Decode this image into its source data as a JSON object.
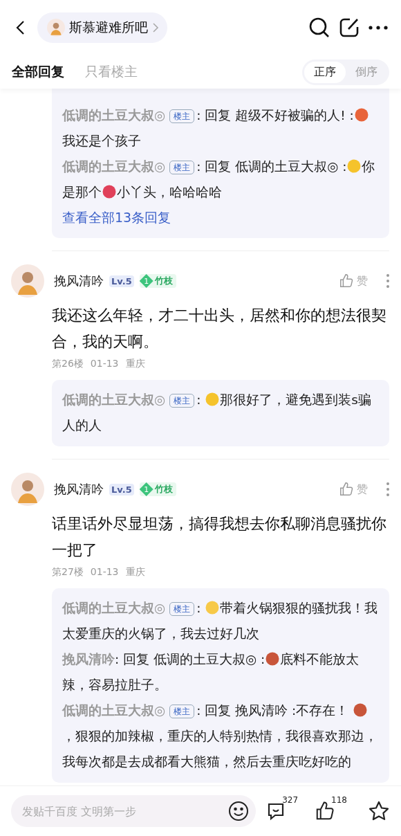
{
  "header": {
    "forum_name": "斯慕避难所吧"
  },
  "tabs": [
    {
      "label": "全部回复",
      "selected": true
    },
    {
      "label": "只看楼主",
      "selected": false
    }
  ],
  "sort": [
    {
      "label": "正序",
      "selected": true
    },
    {
      "label": "倒序",
      "selected": false
    }
  ],
  "thread_tail": {
    "replies": [
      {
        "author": "低调的土豆大叔◎",
        "badge": "楼主",
        "segments": [
          {
            "kind": "text",
            "text": ":  回复 超级不好被骗的人! :"
          },
          {
            "kind": "emoji",
            "color": "#e8643a"
          },
          {
            "kind": "text",
            "text": "我还是个孩子"
          }
        ]
      },
      {
        "author": "低调的土豆大叔◎",
        "badge": "楼主",
        "segments": [
          {
            "kind": "text",
            "text": ":  回复 低调的土豆大叔◎ :"
          },
          {
            "kind": "emoji",
            "color": "#f5c32c"
          },
          {
            "kind": "text",
            "text": "你是那个"
          },
          {
            "kind": "emoji",
            "color": "#e0405a"
          },
          {
            "kind": "text",
            "text": "小丫头，哈哈哈哈"
          }
        ]
      }
    ],
    "more_link": "查看全部13条回复"
  },
  "posts": [
    {
      "author": "挽风清吟",
      "level": "Lv.5",
      "rank_number": "1",
      "rank": "竹枝",
      "like_label": "赞",
      "body": "我还这么年轻，才二十出头，居然和你的想法很契合，我的天啊。",
      "meta": [
        "第26楼",
        "01-13",
        "重庆"
      ],
      "replies": [
        {
          "author": "低调的土豆大叔◎",
          "badge": "楼主",
          "segments": [
            {
              "kind": "text",
              "text": ":  "
            },
            {
              "kind": "emoji",
              "color": "#f5c32c"
            },
            {
              "kind": "text",
              "text": "那很好了，避免遇到装s骗人的人"
            }
          ]
        }
      ]
    },
    {
      "author": "挽风清吟",
      "level": "Lv.5",
      "rank_number": "1",
      "rank": "竹枝",
      "like_label": "赞",
      "body": "话里话外尽显坦荡，搞得我想去你私聊消息骚扰你一把了",
      "meta": [
        "第27楼",
        "01-13",
        "重庆"
      ],
      "replies": [
        {
          "author": "低调的土豆大叔◎",
          "badge": "楼主",
          "segments": [
            {
              "kind": "text",
              "text": ":  "
            },
            {
              "kind": "emoji",
              "color": "#f7c948"
            },
            {
              "kind": "text",
              "text": "带着火锅狠狠的骚扰我！我太爱重庆的火锅了，我去过好几次"
            }
          ]
        },
        {
          "author": "挽风清吟",
          "segments": [
            {
              "kind": "text",
              "text": ":  回复 低调的土豆大叔◎ :"
            },
            {
              "kind": "emoji",
              "color": "#c8553a"
            },
            {
              "kind": "text",
              "text": "底料不能放太辣，容易拉肚子。"
            }
          ]
        },
        {
          "author": "低调的土豆大叔◎",
          "badge": "楼主",
          "segments": [
            {
              "kind": "text",
              "text": ":  回复 挽风清吟 :不存在！ "
            },
            {
              "kind": "emoji",
              "color": "#c8553a"
            },
            {
              "kind": "text",
              "text": "，狠狠的加辣椒，重庆的人特别热情，我很喜欢那边，我每次都是去成都看大熊猫，然后去重庆吃好吃的"
            }
          ]
        }
      ]
    }
  ],
  "bottom_bar": {
    "placeholder": "发贴千百度 文明第一步",
    "comment_count": "327",
    "like_count": "118"
  }
}
